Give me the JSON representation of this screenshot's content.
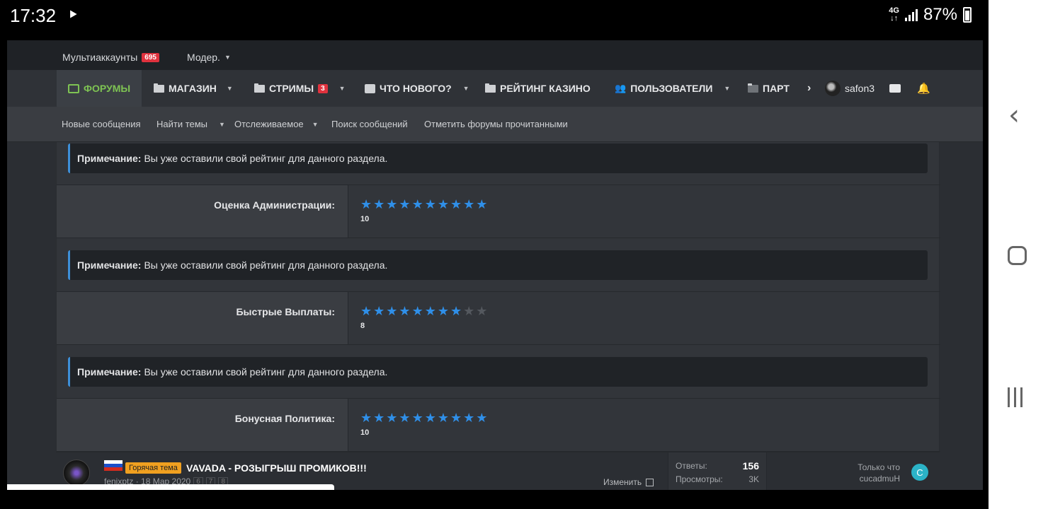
{
  "status_bar": {
    "time": "17:32",
    "play_icon": "play-store-icon",
    "network": [
      "4G",
      "↓↑"
    ],
    "battery": "87%"
  },
  "topbar": {
    "multiaccounts_label": "Мультиаккаунты",
    "multiaccounts_count": "695",
    "moder_label": "Модер."
  },
  "mainnav": {
    "forums": "ФОРУМЫ",
    "shop": "МАГАЗИН",
    "streams": "СТРИМЫ",
    "streams_count": "3",
    "whats_new": "ЧТО НОВОГО?",
    "casino_rating": "РЕЙТИНГ КАЗИНО",
    "users": "ПОЛЬЗОВАТЕЛИ",
    "partners": "ПАРТ",
    "more": "›",
    "username": "safon3",
    "accent_color": "#7ec353"
  },
  "subnav": {
    "new_posts": "Новые сообщения",
    "find_threads": "Найти темы",
    "watched": "Отслеживаемое",
    "search_posts": "Поиск сообщений",
    "mark_read": "Отметить форумы прочитанными"
  },
  "notes": {
    "prefix": "Примечание:",
    "text": "Вы уже оставили свой рейтинг для данного раздела."
  },
  "ratings": [
    {
      "label": "Оценка Администрации:",
      "score": "10",
      "value": 10,
      "max": 10
    },
    {
      "label": "Быстрые Выплаты:",
      "score": "8",
      "value": 8,
      "max": 10
    },
    {
      "label": "Бонусная Политика:",
      "score": "10",
      "value": 10,
      "max": 10
    }
  ],
  "thread": {
    "hot_label": "Горячая тема",
    "title": "VAVADA - РОЗЫГРЫШ ПРОМИКОВ!!!",
    "author_date": "fenixptz · 18 Мар 2020",
    "pages": [
      "6",
      "7",
      "8"
    ],
    "edit_label": "Изменить",
    "replies_label": "Ответы:",
    "replies_value": "156",
    "views_label": "Просмотры:",
    "views_value": "3K",
    "last_time": "Только что",
    "last_user": "cucadmuH",
    "last_avatar_letter": "C"
  }
}
